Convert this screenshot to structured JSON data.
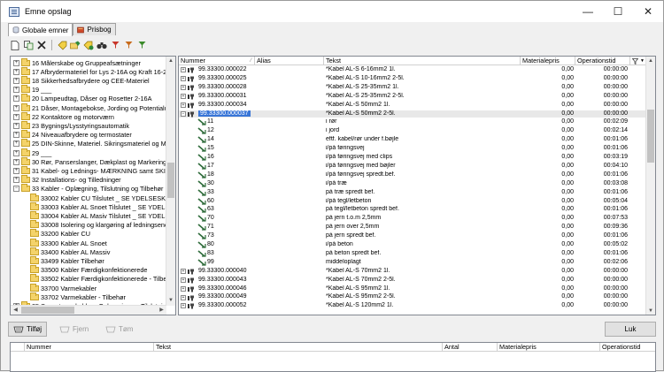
{
  "window": {
    "title": "Emne opslag"
  },
  "tabs": [
    {
      "label": "Globale emner"
    },
    {
      "label": "Prisbog"
    }
  ],
  "tree": {
    "items": [
      {
        "label": "16 Målerskabe og Gruppeafsætninger",
        "level": 0,
        "expander": "+"
      },
      {
        "label": "17 Afbrydermateriel for Lys 2-16A og Kraft 16-25A",
        "level": 0,
        "expander": "+"
      },
      {
        "label": "18 Sikkerhedsafbrydere og CEE-Materiel",
        "level": 0,
        "expander": "+"
      },
      {
        "label": "19 ___",
        "level": 0,
        "expander": "+"
      },
      {
        "label": "20 Lampeudtag, Dåser og Rosetter 2-16A",
        "level": 0,
        "expander": "+"
      },
      {
        "label": "21 Dåser, Montagebokse, Jording og Potentialudligning",
        "level": 0,
        "expander": "+"
      },
      {
        "label": "22 Kontaktore og motorværn",
        "level": 0,
        "expander": "+"
      },
      {
        "label": "23 Bygnings/Lysstyringsautomatik",
        "level": 0,
        "expander": "+"
      },
      {
        "label": "24 Niveauafbrydere og termostater",
        "level": 0,
        "expander": "+"
      },
      {
        "label": "25 DIN-Skinne, Materiel. Sikringsmateriel og Mellemsikringer",
        "level": 0,
        "expander": "+"
      },
      {
        "label": "29 ___",
        "level": 0,
        "expander": "+"
      },
      {
        "label": "30 Rør, Panserslanger, Dækplast og Markeringsbånd",
        "level": 0,
        "expander": "+"
      },
      {
        "label": "31 Kabel- og Lednings- MÆRKNING samt SKILTE",
        "level": 0,
        "expander": "+"
      },
      {
        "label": "32 Installations- og Tilledninger",
        "level": 0,
        "expander": "+"
      },
      {
        "label": "33 Kabler - Oplægning, Tilslutning og Tilbehør",
        "level": 0,
        "expander": "-"
      },
      {
        "label": "33002 Kabler CU Tilslutet _ SE YDELSESKATALOG",
        "level": 1
      },
      {
        "label": "33003 Kabler AL Snoet Tilslutet _ SE YDELSESKATALOG",
        "level": 1
      },
      {
        "label": "33004 Kabler AL Masiv Tilslutet _ SE YDELSESKATALOG",
        "level": 1
      },
      {
        "label": "33008 Isolering og klargøring af ledningsender",
        "level": 1
      },
      {
        "label": "33200 Kabler CU",
        "level": 1
      },
      {
        "label": "33300 Kabler AL Snoet",
        "level": 1
      },
      {
        "label": "33400 Kabler AL Massiv",
        "level": 1
      },
      {
        "label": "33499 Kabler Tilbehør",
        "level": 1
      },
      {
        "label": "33500 Kabler Færdigkonfektionerede",
        "level": 1
      },
      {
        "label": "33502 Kabler Færdigkonfektionerede - Tilbehør",
        "level": 1
      },
      {
        "label": "33700 Varmekabler",
        "level": 1
      },
      {
        "label": "33702 Varmekabler - Tilbehør",
        "level": 1
      },
      {
        "label": "35 Svagstrømskabler - Oplægning og Tilslutning",
        "level": 0,
        "expander": "+"
      }
    ]
  },
  "grid": {
    "columns": {
      "nummer": "Nummer",
      "alias": "Alias",
      "tekst": "Tekst",
      "materialepris": "Materialepris",
      "operationstid": "Operationstid"
    },
    "rows": [
      {
        "kind": "parent",
        "pm": "+",
        "nummer": "99.33300.000022",
        "tekst": "*Kabel AL-S 6-16mm2 1l.",
        "pris": "0,00",
        "tid": "00:00:00"
      },
      {
        "kind": "parent",
        "pm": "+",
        "nummer": "99.33300.000025",
        "tekst": "*Kabel AL-S 10-16mm2 2-5l.",
        "pris": "0,00",
        "tid": "00:00:00"
      },
      {
        "kind": "parent",
        "pm": "+",
        "nummer": "99.33300.000028",
        "tekst": "*Kabel AL-S 25-35mm2 1l.",
        "pris": "0,00",
        "tid": "00:00:00"
      },
      {
        "kind": "parent",
        "pm": "+",
        "nummer": "99.33300.000031",
        "tekst": "*Kabel AL-S 25-35mm2 2-5l.",
        "pris": "0,00",
        "tid": "00:00:00"
      },
      {
        "kind": "parent",
        "pm": "+",
        "nummer": "99.33300.000034",
        "tekst": "*Kabel AL-S 50mm2 1l.",
        "pris": "0,00",
        "tid": "00:00:00"
      },
      {
        "kind": "parent-sel",
        "pm": "-",
        "nummer": "99.33300.000037",
        "tekst": "*Kabel AL-S 50mm2 2-5l.",
        "pris": "0,00",
        "tid": "00:00:00"
      },
      {
        "kind": "child",
        "nummer": "11",
        "tekst": "i rør",
        "pris": "0,00",
        "tid": "00:02:09"
      },
      {
        "kind": "child",
        "nummer": "12",
        "tekst": "i jord",
        "pris": "0,00",
        "tid": "00:02:14"
      },
      {
        "kind": "child",
        "nummer": "14",
        "tekst": "eftf. kabel/rør under f.bøjle",
        "pris": "0,00",
        "tid": "00:01:06"
      },
      {
        "kind": "child",
        "nummer": "15",
        "tekst": "i/på føringsvej",
        "pris": "0,00",
        "tid": "00:01:06"
      },
      {
        "kind": "child",
        "nummer": "16",
        "tekst": "i/på føringsvej med clips",
        "pris": "0,00",
        "tid": "00:03:19"
      },
      {
        "kind": "child",
        "nummer": "17",
        "tekst": "i/på føringsvej med bøjler",
        "pris": "0,00",
        "tid": "00:04:10"
      },
      {
        "kind": "child",
        "nummer": "18",
        "tekst": "i/på føringsvej spredt.bef.",
        "pris": "0,00",
        "tid": "00:01:06"
      },
      {
        "kind": "child",
        "nummer": "30",
        "tekst": "i/på træ",
        "pris": "0,00",
        "tid": "00:03:08"
      },
      {
        "kind": "child",
        "nummer": "33",
        "tekst": "på træ spredt bef.",
        "pris": "0,00",
        "tid": "00:01:06"
      },
      {
        "kind": "child",
        "nummer": "60",
        "tekst": "i/på tegl/letbeton",
        "pris": "0,00",
        "tid": "00:05:04"
      },
      {
        "kind": "child",
        "nummer": "63",
        "tekst": "på tegl/letbeton spredt bef.",
        "pris": "0,00",
        "tid": "00:01:06"
      },
      {
        "kind": "child",
        "nummer": "70",
        "tekst": "på jern t.o.m 2,5mm",
        "pris": "0,00",
        "tid": "00:07:53"
      },
      {
        "kind": "child",
        "nummer": "71",
        "tekst": "på jern over 2,5mm",
        "pris": "0,00",
        "tid": "00:09:36"
      },
      {
        "kind": "child",
        "nummer": "73",
        "tekst": "på jern spredt bef.",
        "pris": "0,00",
        "tid": "00:01:06"
      },
      {
        "kind": "child",
        "nummer": "80",
        "tekst": "i/på beton",
        "pris": "0,00",
        "tid": "00:05:02"
      },
      {
        "kind": "child",
        "nummer": "83",
        "tekst": "på beton spredt bef.",
        "pris": "0,00",
        "tid": "00:01:06"
      },
      {
        "kind": "child",
        "nummer": "99",
        "tekst": "middeloplagt",
        "pris": "0,00",
        "tid": "00:02:06"
      },
      {
        "kind": "parent",
        "pm": "+",
        "nummer": "99.33300.000040",
        "tekst": "*Kabel AL-S 70mm2 1l.",
        "pris": "0,00",
        "tid": "00:00:00"
      },
      {
        "kind": "parent",
        "pm": "+",
        "nummer": "99.33300.000043",
        "tekst": "*Kabel AL-S 70mm2 2-5l.",
        "pris": "0,00",
        "tid": "00:00:00"
      },
      {
        "kind": "parent",
        "pm": "+",
        "nummer": "99.33300.000046",
        "tekst": "*Kabel AL-S 95mm2 1l.",
        "pris": "0,00",
        "tid": "00:00:00"
      },
      {
        "kind": "parent",
        "pm": "+",
        "nummer": "99.33300.000049",
        "tekst": "*Kabel AL-S 95mm2 2-5l.",
        "pris": "0,00",
        "tid": "00:00:00"
      },
      {
        "kind": "parent",
        "pm": "+",
        "nummer": "99.33300.000052",
        "tekst": "*Kabel AL-S 120mm2 1l.",
        "pris": "0,00",
        "tid": "00:00:00"
      }
    ]
  },
  "buttons": {
    "tilfoej": "Tilføj",
    "fjern": "Fjern",
    "tom": "Tøm",
    "luk": "Luk"
  },
  "lower": {
    "columns": {
      "nummer": "Nummer",
      "tekst": "Tekst",
      "antal": "Antal",
      "materialepris": "Materialepris",
      "operationstid": "Operationstid"
    }
  },
  "colors": {
    "selection": "#3875d7",
    "folder": "#f4d36a",
    "arrow": "#2e6b3a"
  }
}
